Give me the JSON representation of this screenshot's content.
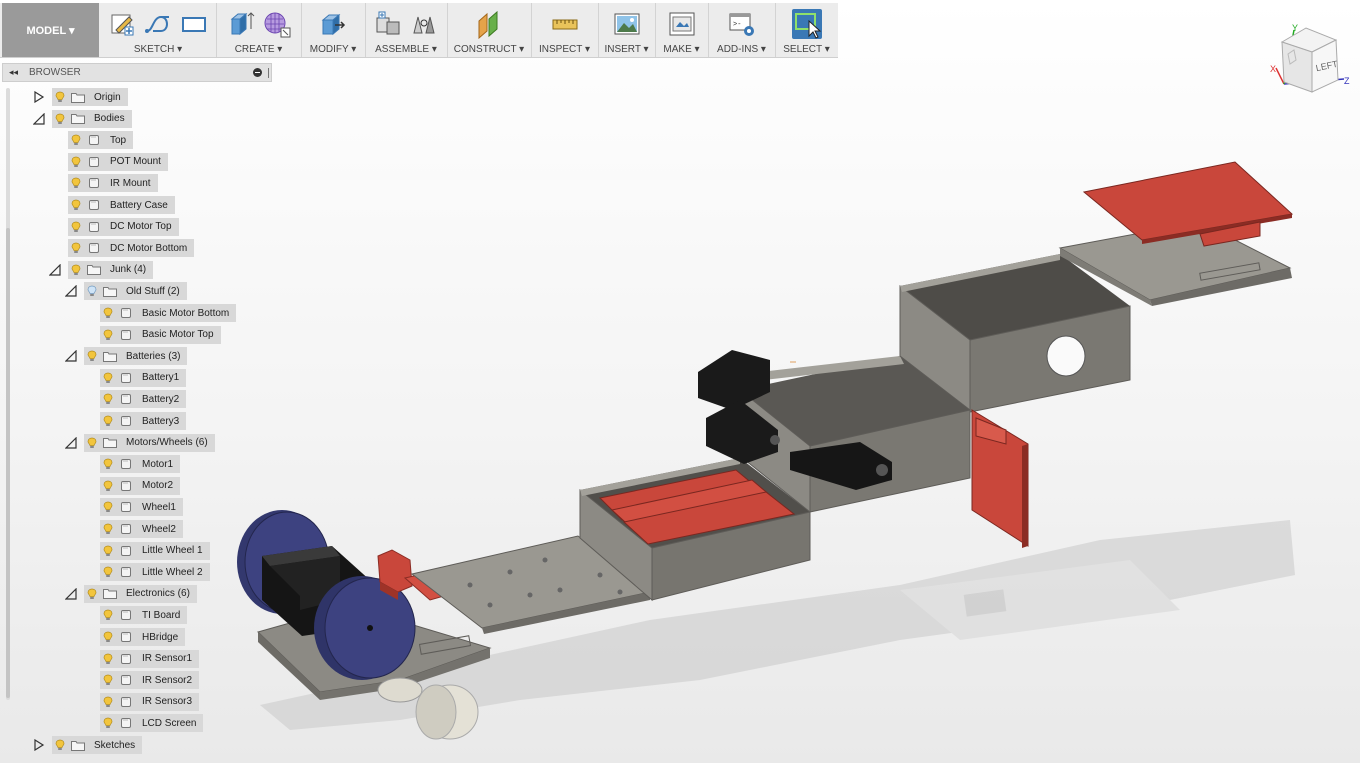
{
  "toolbar": {
    "workspace": "MODEL ▾",
    "groups": [
      {
        "label": "SKETCH ▾"
      },
      {
        "label": "CREATE ▾"
      },
      {
        "label": "MODIFY ▾"
      },
      {
        "label": "ASSEMBLE ▾"
      },
      {
        "label": "CONSTRUCT ▾"
      },
      {
        "label": "INSPECT ▾"
      },
      {
        "label": "INSERT ▾"
      },
      {
        "label": "MAKE ▾"
      },
      {
        "label": "ADD-INS ▾"
      },
      {
        "label": "SELECT ▾"
      }
    ]
  },
  "browser": {
    "title": "BROWSER",
    "collapse_glyph": "◂◂",
    "nodes": [
      {
        "label": "Origin",
        "icon": "folder-icon"
      },
      {
        "label": "Bodies",
        "icon": "folder-icon"
      },
      {
        "label": "Top",
        "icon": "body-icon"
      },
      {
        "label": "POT Mount",
        "icon": "body-icon"
      },
      {
        "label": "IR Mount",
        "icon": "body-icon"
      },
      {
        "label": "Battery Case",
        "icon": "body-icon"
      },
      {
        "label": "DC Motor Top",
        "icon": "body-icon"
      },
      {
        "label": "DC Motor Bottom",
        "icon": "body-icon"
      },
      {
        "label": "Junk (4)",
        "icon": "folder-icon"
      },
      {
        "label": "Old Stuff (2)",
        "icon": "folder-icon"
      },
      {
        "label": "Basic Motor Bottom",
        "icon": "body-icon"
      },
      {
        "label": "Basic Motor Top",
        "icon": "body-icon"
      },
      {
        "label": "Batteries (3)",
        "icon": "folder-icon"
      },
      {
        "label": "Battery1",
        "icon": "body-icon"
      },
      {
        "label": "Battery2",
        "icon": "body-icon"
      },
      {
        "label": "Battery3",
        "icon": "body-icon"
      },
      {
        "label": "Motors/Wheels (6)",
        "icon": "folder-icon"
      },
      {
        "label": "Motor1",
        "icon": "body-icon"
      },
      {
        "label": "Motor2",
        "icon": "body-icon"
      },
      {
        "label": "Wheel1",
        "icon": "body-icon"
      },
      {
        "label": "Wheel2",
        "icon": "body-icon"
      },
      {
        "label": "Little Wheel 1",
        "icon": "body-icon"
      },
      {
        "label": "Little Wheel 2",
        "icon": "body-icon"
      },
      {
        "label": "Electronics (6)",
        "icon": "folder-icon"
      },
      {
        "label": "TI Board",
        "icon": "body-icon"
      },
      {
        "label": "HBridge",
        "icon": "body-icon"
      },
      {
        "label": "IR Sensor1",
        "icon": "body-icon"
      },
      {
        "label": "IR Sensor2",
        "icon": "body-icon"
      },
      {
        "label": "IR Sensor3",
        "icon": "body-icon"
      },
      {
        "label": "LCD Screen",
        "icon": "body-icon"
      },
      {
        "label": "Sketches",
        "icon": "folder-icon"
      }
    ]
  },
  "viewcube": {
    "face": "LEFT",
    "axis_x": "X",
    "axis_y": "Y",
    "axis_z": "Z"
  },
  "colors": {
    "body_gray": "#8c8a84",
    "part_red": "#c9473b",
    "wheel_blue": "#3a3f7a",
    "select_blue": "#3a78b5"
  }
}
